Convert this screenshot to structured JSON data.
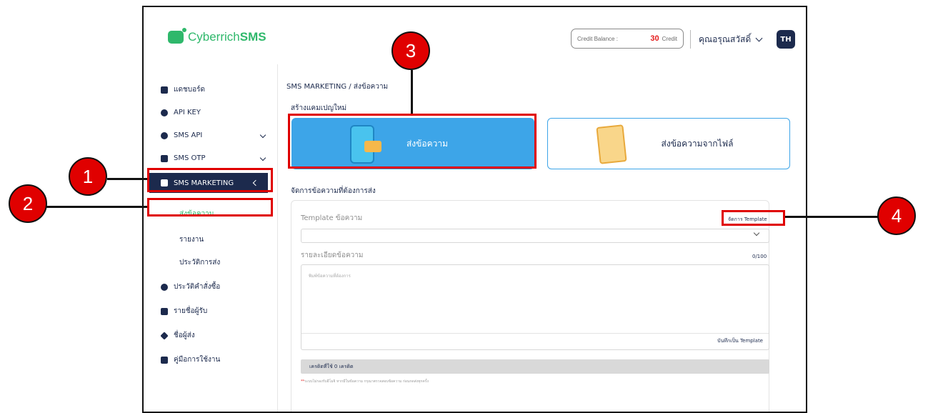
{
  "header": {
    "logo_text_light": "Cyberrich",
    "logo_text_bold": "SMS",
    "credit_label": "Credit Balance :",
    "credit_value": "30",
    "credit_unit": "Credit",
    "user_name": "คุณอรุณสวัสดิ์",
    "lang_badge": "TH"
  },
  "sidebar": {
    "items": [
      {
        "label": "แดชบอร์ด",
        "icon": "dashboard-icon"
      },
      {
        "label": "API KEY",
        "icon": "key-icon"
      },
      {
        "label": "SMS API",
        "icon": "api-icon"
      },
      {
        "label": "SMS OTP",
        "icon": "otp-icon"
      },
      {
        "label": "SMS MARKETING",
        "icon": "marketing-icon"
      },
      {
        "label": "ประวัติคำสั่งซื้อ",
        "icon": "gear-icon"
      },
      {
        "label": "รายชื่อผู้รับ",
        "icon": "contacts-icon"
      },
      {
        "label": "ชื่อผู้ส่ง",
        "icon": "send-icon"
      },
      {
        "label": "คู่มือการใช้งาน",
        "icon": "book-icon"
      }
    ],
    "sub_items": [
      {
        "label": "ส่งข้อความ"
      },
      {
        "label": "รายงาน"
      },
      {
        "label": "ประวัติการส่ง"
      }
    ]
  },
  "main": {
    "breadcrumb": "SMS MARKETING / ส่งข้อความ",
    "create_campaign_title": "สร้างแคมเปญใหม่",
    "card_send": "ส่งข้อความ",
    "card_send_file": "ส่งข้อความจากไฟล์",
    "manage_title": "จัดการข้อความที่ต้องการส่ง",
    "template_label": "Template ข้อความ",
    "manage_template_link": "จัดการ Template",
    "detail_label": "รายละเอียดข้อความ",
    "char_count": "0/100",
    "textarea_placeholder": "พิมพ์ข้อความที่ต้องการ",
    "save_template": "บันทึกเป็น Template",
    "credit_used": "เครดิตที่ใช้ 0 เครดิต",
    "note": "ระบบไม่รองรับอีโมจิ หากมีในข้อความ กรุณาตรวจสอบข้อความ ก่อนกดส่งทุกครั้ง"
  },
  "annotations": {
    "badge_1": "1",
    "badge_2": "2",
    "badge_3": "3",
    "badge_4": "4",
    "highlight_color": "#e00000"
  }
}
